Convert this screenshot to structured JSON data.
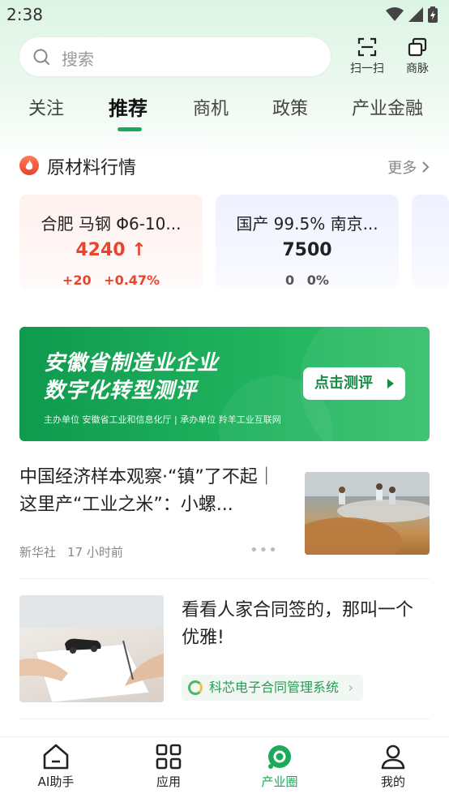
{
  "status_bar": {
    "time": "2:38"
  },
  "search": {
    "placeholder": "搜索"
  },
  "tools": [
    {
      "label": "扫一扫",
      "icon": "scan-icon"
    },
    {
      "label": "商脉",
      "icon": "contacts-icon"
    }
  ],
  "tabs": [
    {
      "label": "关注",
      "active": false
    },
    {
      "label": "推荐",
      "active": true
    },
    {
      "label": "商机",
      "active": false
    },
    {
      "label": "政策",
      "active": false
    },
    {
      "label": "产业金融",
      "active": false
    }
  ],
  "section": {
    "title": "原材料行情",
    "more": "更多"
  },
  "market_cards": [
    {
      "name": "合肥 马钢 Φ6-10...",
      "price": "4240",
      "arrow": "↑",
      "change": "+20",
      "percent": "+0.47%"
    },
    {
      "name": "国产 99.5% 南京...",
      "price": "7500",
      "change": "0",
      "percent": "0%"
    }
  ],
  "banner": {
    "line1": "安徽省制造业企业",
    "line2": "数字化转型测评",
    "button": "点击测评",
    "footer": "主办单位  安徽省工业和信息化厅   |   承办单位  羚羊工业互联网"
  },
  "news": [
    {
      "title": "中国经济样本观察·“镇”了不起｜这里产“工业之米”：小螺...",
      "source": "新华社",
      "time": "17 小时前"
    },
    {
      "title": "看看人家合同签的，那叫一个优雅!",
      "tag": "科芯电子合同管理系统"
    }
  ],
  "bottom_nav": [
    {
      "label": "AI助手",
      "icon": "home-icon",
      "active": false
    },
    {
      "label": "应用",
      "icon": "apps-grid-icon",
      "active": false
    },
    {
      "label": "产业圈",
      "icon": "industry-circle-icon",
      "active": true
    },
    {
      "label": "我的",
      "icon": "profile-icon",
      "active": false
    }
  ],
  "colors": {
    "accent": "#1aaa5a",
    "up_red": "#e8452c",
    "banner_green": "#16a355"
  }
}
